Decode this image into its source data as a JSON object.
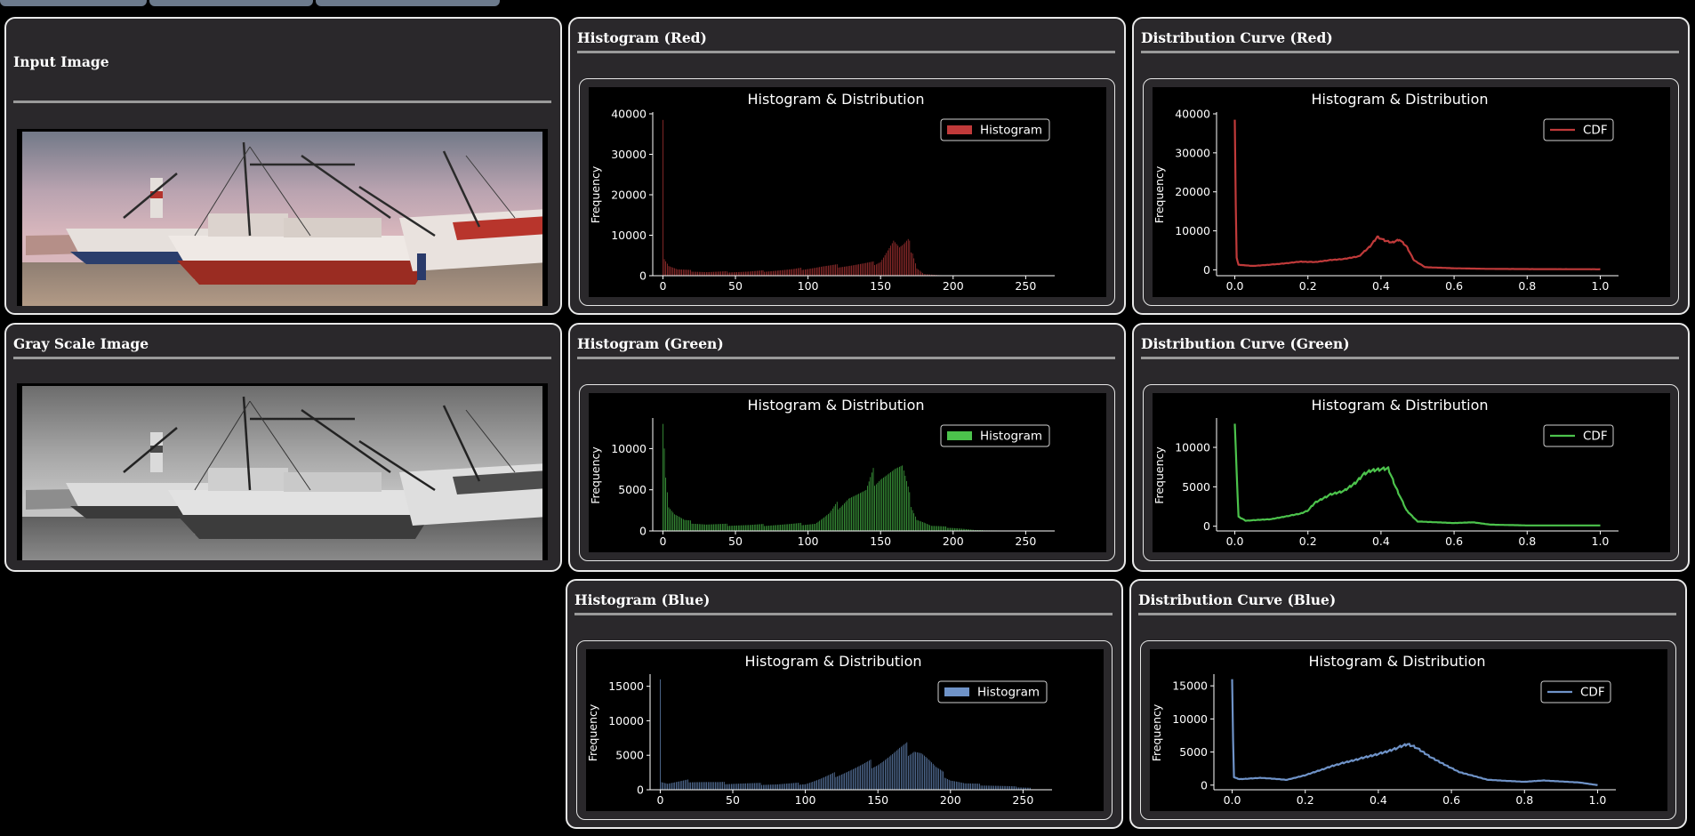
{
  "window": {
    "tabs": [
      "",
      "",
      ""
    ]
  },
  "panels": {
    "input_image": {
      "title": "Input Image"
    },
    "gray_image": {
      "title": "Gray Scale Image"
    },
    "hist_red": {
      "title": "Histogram (Red)"
    },
    "cdf_red": {
      "title": "Distribution Curve (Red)"
    },
    "hist_green": {
      "title": "Histogram (Green)"
    },
    "cdf_green": {
      "title": "Distribution Curve (Green)"
    },
    "hist_blue": {
      "title": "Histogram (Blue)"
    },
    "cdf_blue": {
      "title": "Distribution Curve (Blue)"
    }
  },
  "colors": {
    "red": "#c03a3a",
    "green": "#4cc34c",
    "blue": "#6f93c8",
    "panel_bg": "#2a282b",
    "border": "#e9e9e9"
  },
  "chart_data": [
    {
      "id": "hist_red",
      "type": "bar",
      "color": "#c03a3a",
      "title": "Histogram & Distribution",
      "ylabel": "Frequency",
      "legend": "Histogram",
      "legend_position": "top-right",
      "xlim": [
        -7,
        270
      ],
      "ylim": [
        0,
        40000
      ],
      "xticks": [
        0,
        50,
        100,
        150,
        200,
        250
      ],
      "xtick_labels": [
        "0",
        "50",
        "100",
        "150",
        "200",
        "250"
      ],
      "yticks": [
        0,
        10000,
        20000,
        30000,
        40000
      ],
      "ytick_labels": [
        "0",
        "10000",
        "20000",
        "30000",
        "40000"
      ],
      "profile": [
        [
          0,
          38500
        ],
        [
          1,
          4500
        ],
        [
          4,
          2500
        ],
        [
          10,
          1500
        ],
        [
          30,
          900
        ],
        [
          60,
          1000
        ],
        [
          90,
          1500
        ],
        [
          110,
          2200
        ],
        [
          130,
          2600
        ],
        [
          145,
          3000
        ],
        [
          150,
          3800
        ],
        [
          155,
          6500
        ],
        [
          159,
          8500
        ],
        [
          163,
          6500
        ],
        [
          166,
          7000
        ],
        [
          169,
          7800
        ],
        [
          172,
          6500
        ],
        [
          175,
          2000
        ],
        [
          180,
          400
        ],
        [
          190,
          120
        ],
        [
          200,
          40
        ],
        [
          255,
          10
        ]
      ]
    },
    {
      "id": "cdf_red",
      "type": "line",
      "color": "#c03a3a",
      "title": "Histogram & Distribution",
      "ylabel": "Frequency",
      "legend": "CDF",
      "legend_position": "top-right",
      "xlim": [
        -0.05,
        1.05
      ],
      "ylim": [
        -1500,
        40000
      ],
      "xticks": [
        0,
        0.2,
        0.4,
        0.6,
        0.8,
        1.0
      ],
      "xtick_labels": [
        "0.0",
        "0.2",
        "0.4",
        "0.6",
        "0.8",
        "1.0"
      ],
      "yticks": [
        0,
        10000,
        20000,
        30000,
        40000
      ],
      "ytick_labels": [
        "0",
        "10000",
        "20000",
        "30000",
        "40000"
      ],
      "profile": [
        [
          0,
          38500
        ],
        [
          0.004,
          3500
        ],
        [
          0.01,
          1300
        ],
        [
          0.05,
          1000
        ],
        [
          0.12,
          1500
        ],
        [
          0.18,
          2100
        ],
        [
          0.22,
          2000
        ],
        [
          0.26,
          2500
        ],
        [
          0.3,
          2800
        ],
        [
          0.34,
          3500
        ],
        [
          0.37,
          6000
        ],
        [
          0.39,
          8500
        ],
        [
          0.41,
          7500
        ],
        [
          0.43,
          7000
        ],
        [
          0.45,
          7800
        ],
        [
          0.47,
          6000
        ],
        [
          0.49,
          2500
        ],
        [
          0.52,
          700
        ],
        [
          0.6,
          400
        ],
        [
          0.7,
          250
        ],
        [
          0.8,
          200
        ],
        [
          1.0,
          150
        ]
      ]
    },
    {
      "id": "hist_green",
      "type": "bar",
      "color": "#4cc34c",
      "title": "Histogram & Distribution",
      "ylabel": "Frequency",
      "legend": "Histogram",
      "legend_position": "top-right",
      "xlim": [
        -7,
        270
      ],
      "ylim": [
        0,
        13500
      ],
      "xticks": [
        0,
        50,
        100,
        150,
        200,
        250
      ],
      "xtick_labels": [
        "0",
        "50",
        "100",
        "150",
        "200",
        "250"
      ],
      "yticks": [
        0,
        5000,
        10000
      ],
      "ytick_labels": [
        "0",
        "5000",
        "10000"
      ],
      "profile": [
        [
          0,
          13000
        ],
        [
          1,
          11000
        ],
        [
          2,
          7000
        ],
        [
          4,
          3000
        ],
        [
          8,
          2000
        ],
        [
          15,
          1200
        ],
        [
          30,
          800
        ],
        [
          60,
          700
        ],
        [
          90,
          800
        ],
        [
          105,
          900
        ],
        [
          115,
          2000
        ],
        [
          120,
          3000
        ],
        [
          128,
          4200
        ],
        [
          140,
          4500
        ],
        [
          145,
          6500
        ],
        [
          150,
          7000
        ],
        [
          160,
          7300
        ],
        [
          165,
          7200
        ],
        [
          170,
          4000
        ],
        [
          175,
          1500
        ],
        [
          185,
          600
        ],
        [
          200,
          400
        ],
        [
          215,
          100
        ],
        [
          255,
          0
        ]
      ]
    },
    {
      "id": "cdf_green",
      "type": "line",
      "color": "#4cc34c",
      "title": "Histogram & Distribution",
      "ylabel": "Frequency",
      "legend": "CDF",
      "legend_position": "top-right",
      "xlim": [
        -0.05,
        1.05
      ],
      "ylim": [
        -600,
        13500
      ],
      "xticks": [
        0,
        0.2,
        0.4,
        0.6,
        0.8,
        1.0
      ],
      "xtick_labels": [
        "0.0",
        "0.2",
        "0.4",
        "0.6",
        "0.8",
        "1.0"
      ],
      "yticks": [
        0,
        5000,
        10000
      ],
      "ytick_labels": [
        "0",
        "5000",
        "10000"
      ],
      "profile": [
        [
          0,
          13000
        ],
        [
          0.004,
          8000
        ],
        [
          0.01,
          1200
        ],
        [
          0.03,
          700
        ],
        [
          0.1,
          900
        ],
        [
          0.18,
          1600
        ],
        [
          0.2,
          2000
        ],
        [
          0.22,
          3000
        ],
        [
          0.26,
          4000
        ],
        [
          0.3,
          4500
        ],
        [
          0.33,
          5500
        ],
        [
          0.35,
          6500
        ],
        [
          0.37,
          7000
        ],
        [
          0.39,
          7200
        ],
        [
          0.42,
          7300
        ],
        [
          0.44,
          5000
        ],
        [
          0.47,
          2000
        ],
        [
          0.5,
          600
        ],
        [
          0.6,
          400
        ],
        [
          0.65,
          500
        ],
        [
          0.7,
          200
        ],
        [
          0.8,
          100
        ],
        [
          1.0,
          100
        ]
      ]
    },
    {
      "id": "hist_blue",
      "type": "bar",
      "color": "#6f93c8",
      "title": "Histogram & Distribution",
      "ylabel": "Frequency",
      "legend": "Histogram",
      "legend_position": "top-right",
      "xlim": [
        -7,
        270
      ],
      "ylim": [
        0,
        16500
      ],
      "xticks": [
        0,
        50,
        100,
        150,
        200,
        250
      ],
      "xtick_labels": [
        "0",
        "50",
        "100",
        "150",
        "200",
        "250"
      ],
      "yticks": [
        0,
        5000,
        10000,
        15000
      ],
      "ytick_labels": [
        "0",
        "5000",
        "10000",
        "15000"
      ],
      "profile": [
        [
          0,
          16000
        ],
        [
          1,
          1200
        ],
        [
          5,
          900
        ],
        [
          20,
          1300
        ],
        [
          40,
          1000
        ],
        [
          80,
          800
        ],
        [
          100,
          900
        ],
        [
          110,
          1500
        ],
        [
          130,
          2800
        ],
        [
          150,
          4000
        ],
        [
          165,
          5500
        ],
        [
          175,
          6200
        ],
        [
          180,
          5500
        ],
        [
          190,
          3000
        ],
        [
          200,
          1500
        ],
        [
          210,
          900
        ],
        [
          230,
          600
        ],
        [
          255,
          300
        ]
      ]
    },
    {
      "id": "cdf_blue",
      "type": "line",
      "color": "#6f93c8",
      "title": "Histogram & Distribution",
      "ylabel": "Frequency",
      "legend": "CDF",
      "legend_position": "top-right",
      "xlim": [
        -0.05,
        1.05
      ],
      "ylim": [
        -700,
        16500
      ],
      "xticks": [
        0,
        0.2,
        0.4,
        0.6,
        0.8,
        1.0
      ],
      "xtick_labels": [
        "0.0",
        "0.2",
        "0.4",
        "0.6",
        "0.8",
        "1.0"
      ],
      "yticks": [
        0,
        5000,
        10000,
        15000
      ],
      "ytick_labels": [
        "0",
        "5000",
        "10000",
        "15000"
      ],
      "profile": [
        [
          0,
          16000
        ],
        [
          0.004,
          1200
        ],
        [
          0.02,
          900
        ],
        [
          0.08,
          1100
        ],
        [
          0.15,
          800
        ],
        [
          0.2,
          1500
        ],
        [
          0.28,
          3000
        ],
        [
          0.35,
          4000
        ],
        [
          0.42,
          5000
        ],
        [
          0.48,
          6200
        ],
        [
          0.5,
          5800
        ],
        [
          0.55,
          4000
        ],
        [
          0.62,
          2000
        ],
        [
          0.7,
          800
        ],
        [
          0.8,
          500
        ],
        [
          0.85,
          700
        ],
        [
          0.95,
          400
        ],
        [
          1.0,
          0
        ]
      ]
    }
  ]
}
